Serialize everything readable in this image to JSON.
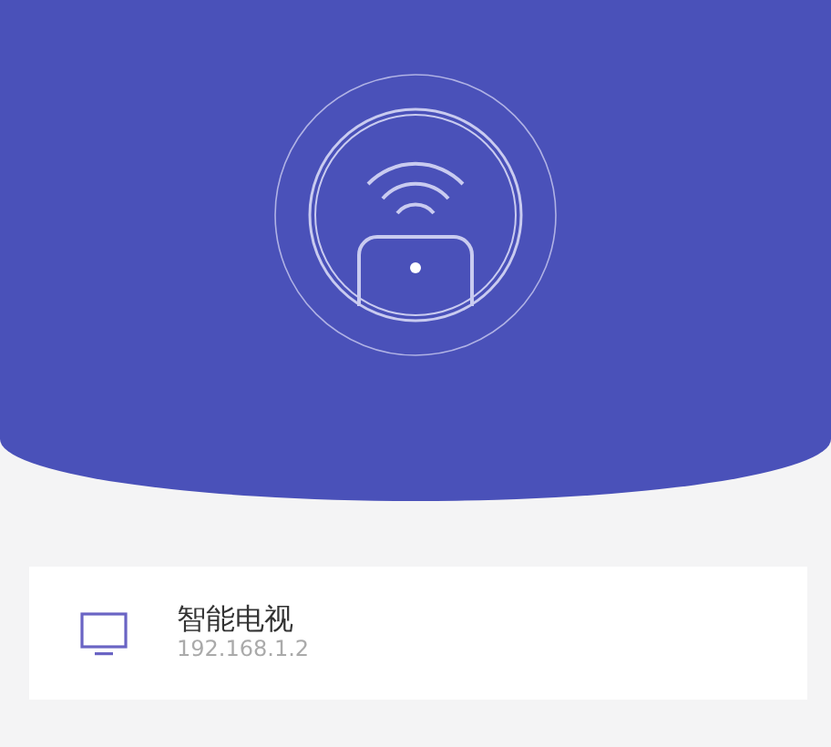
{
  "devices": [
    {
      "name": "智能电视",
      "address": "192.168.1.2"
    }
  ]
}
